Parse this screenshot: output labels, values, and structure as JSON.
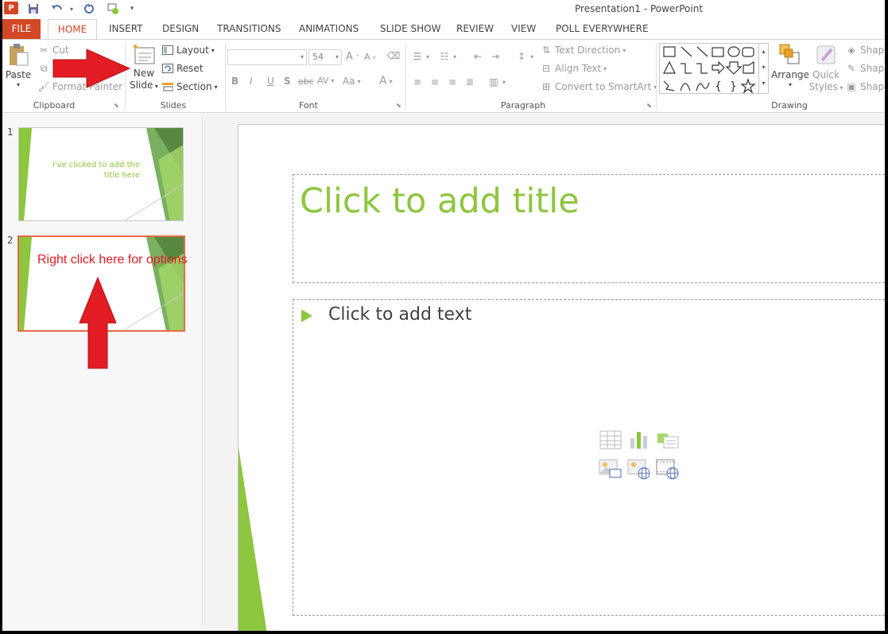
{
  "window": {
    "title": "Presentation1 - PowerPoint",
    "logo": "P"
  },
  "tabs": [
    {
      "label": "FILE"
    },
    {
      "label": "HOME"
    },
    {
      "label": "INSERT"
    },
    {
      "label": "DESIGN"
    },
    {
      "label": "TRANSITIONS"
    },
    {
      "label": "ANIMATIONS"
    },
    {
      "label": "SLIDE SHOW"
    },
    {
      "label": "REVIEW"
    },
    {
      "label": "VIEW"
    },
    {
      "label": "POLL EVERYWHERE"
    }
  ],
  "clipboard": {
    "group_label": "Clipboard",
    "paste": "Paste",
    "cut": "Cut",
    "copy": "C",
    "format_painter": "Format Painter"
  },
  "slides_group": {
    "group_label": "Slides",
    "new_slide_1": "New",
    "new_slide_2": "Slide",
    "layout": "Layout",
    "reset": "Reset",
    "section": "Section"
  },
  "font_group": {
    "group_label": "Font",
    "font_size": "54",
    "bold": "B",
    "italic": "I",
    "underline": "U",
    "shadow": "S",
    "strike": "abc",
    "spacing": "AV",
    "case": "Aa",
    "color": "A",
    "grow": "A",
    "shrink": "A"
  },
  "paragraph_group": {
    "group_label": "Paragraph",
    "text_direction": "Text Direction",
    "align_text": "Align Text",
    "convert_smartart": "Convert to SmartArt"
  },
  "drawing_group": {
    "group_label": "Drawing",
    "arrange": "Arrange",
    "quick_1": "Quick",
    "quick_2": "Styles",
    "shape_1": "Shape",
    "shape_2": "Shape",
    "shape_3": "Shape"
  },
  "thumbnails": [
    {
      "number": "1",
      "title_line1": "I've clicked to add the",
      "title_line2": "title here"
    },
    {
      "number": "2"
    }
  ],
  "annotation": {
    "text": "Right click here for options"
  },
  "slide": {
    "title_placeholder": "Click to add title",
    "body_placeholder": "Click to add text"
  },
  "colors": {
    "accent": "#d24726",
    "green": "#8dc63f",
    "red_arrow": "#e31b23",
    "selected_border": "#e76a45"
  }
}
